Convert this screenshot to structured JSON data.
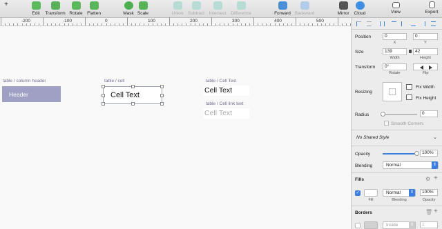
{
  "toolbar": {
    "items": [
      {
        "label": "+",
        "name": "insert"
      },
      {
        "label": "Edit"
      },
      {
        "label": "Transform"
      },
      {
        "label": "Rotate"
      },
      {
        "label": "Flatten"
      },
      {
        "label": "Mask"
      },
      {
        "label": "Scale"
      },
      {
        "label": "Union"
      },
      {
        "label": "Subtract"
      },
      {
        "label": "Intersect"
      },
      {
        "label": "Difference"
      },
      {
        "label": "Forward"
      },
      {
        "label": "Backward"
      },
      {
        "label": "Mirror"
      },
      {
        "label": "Cloud"
      },
      {
        "label": "View"
      },
      {
        "label": "Export"
      }
    ]
  },
  "ruler": {
    "labels": [
      "-200",
      "-100",
      "0",
      "100",
      "200",
      "300",
      "400",
      "500"
    ]
  },
  "canvas": {
    "header_label": "table / column header",
    "header_text": "Header",
    "cell_label": "table / cell",
    "cell_text": "Cell Text",
    "celltext_label": "table / Cell Text",
    "celltext_text": "Cell Text",
    "celllink_label": "table / Cell link text",
    "celllink_text": "Cell Text"
  },
  "inspector": {
    "position_label": "Position",
    "x_value": "0",
    "y_value": "0",
    "x_label": "X",
    "y_label": "Y",
    "size_label": "Size",
    "width_value": "139",
    "height_value": "42",
    "width_label": "Width",
    "height_label": "Height",
    "transform_label": "Transform",
    "rotate_value": "0°",
    "rotate_label": "Rotate",
    "flip_label": "Flip",
    "resizing_label": "Resizing",
    "fix_width": "Fix Width",
    "fix_height": "Fix Height",
    "radius_label": "Radius",
    "radius_value": "0",
    "smooth_corners": "Smooth Corners",
    "shared_style": "No Shared Style",
    "opacity_label": "Opacity",
    "opacity_value": "100%",
    "opacity_level": 1.0,
    "blending_label": "Blending",
    "blending_value": "Normal",
    "fills_label": "Fills",
    "fill_blend": "Normal",
    "fill_opacity": "100%",
    "fill_sub": "Fill",
    "blending_sub": "Blending",
    "opacity_sub": "Opacity",
    "borders_label": "Borders",
    "border_position": "Inside",
    "border_width": "1"
  },
  "colors": {
    "header_fill": "#9fa0c4",
    "accent": "#3a7fe0"
  }
}
